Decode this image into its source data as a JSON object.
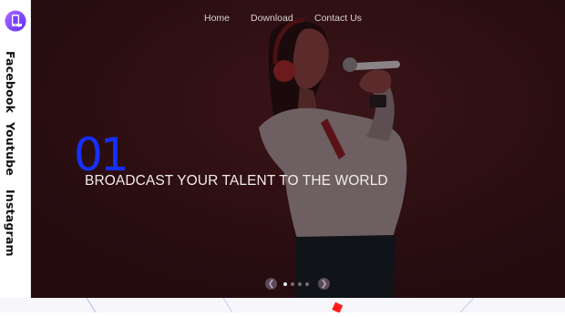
{
  "nav": {
    "items": [
      {
        "label": "Home"
      },
      {
        "label": "Download"
      },
      {
        "label": "Contact Us"
      }
    ]
  },
  "social": {
    "items": [
      {
        "label": "Facebook"
      },
      {
        "label": "Youtube"
      },
      {
        "label": "Instagram"
      }
    ]
  },
  "hero": {
    "slide_number": "01",
    "headline": "BROADCAST YOUR TALENT TO THE WORLD",
    "slides_total": 4,
    "active_slide": 1
  },
  "colors": {
    "accent": "#1530ff",
    "hero_bg": "#260d10",
    "logo": "#7b3cff"
  },
  "icons": {
    "logo": "phone-chat-logo-icon",
    "prev": "arrow-left-icon",
    "next": "arrow-right-icon"
  }
}
